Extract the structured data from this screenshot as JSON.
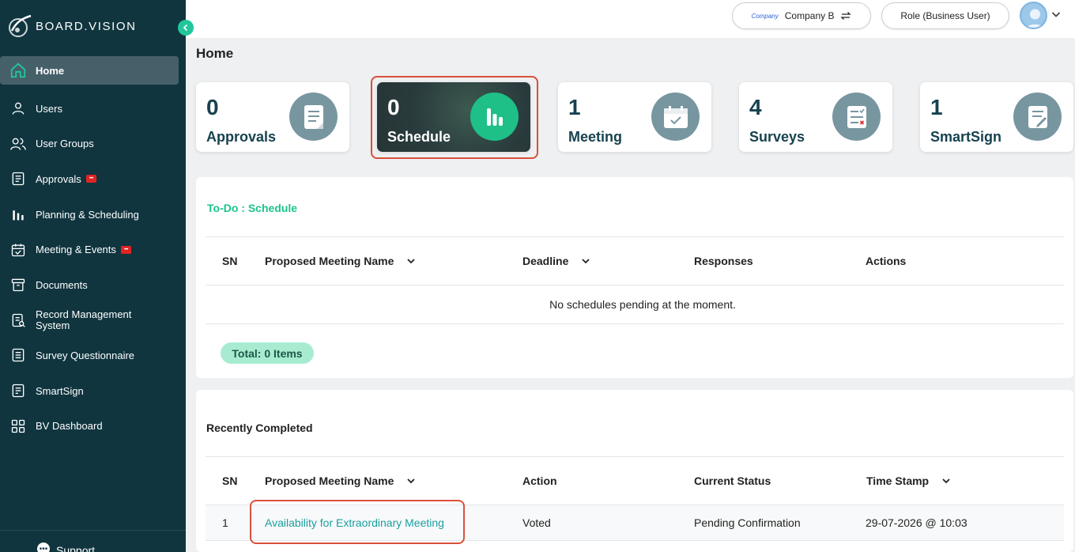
{
  "sidebar": {
    "logo_text": "BOARD.VISION",
    "items": [
      {
        "label": "Home",
        "icon": "home-icon",
        "active": true
      },
      {
        "label": "Users",
        "icon": "user-icon"
      },
      {
        "label": "User Groups",
        "icon": "users-icon"
      },
      {
        "label": "Approvals",
        "icon": "document-icon",
        "badge": true
      },
      {
        "label": "Planning & Scheduling",
        "icon": "bar-chart-icon"
      },
      {
        "label": "Meeting & Events",
        "icon": "calendar-check-icon",
        "badge": true
      },
      {
        "label": "Documents",
        "icon": "archive-icon"
      },
      {
        "label": "Record Management System",
        "icon": "record-icon"
      },
      {
        "label": "Survey Questionnaire",
        "icon": "survey-icon"
      },
      {
        "label": "SmartSign",
        "icon": "sign-icon"
      },
      {
        "label": "BV Dashboard",
        "icon": "grid-icon"
      }
    ],
    "support_label": "Support"
  },
  "topbar": {
    "company_logo_text": "Company",
    "company_label": "Company B",
    "role_label": "Role (Business User)"
  },
  "page_title": "Home",
  "cards": [
    {
      "count": "0",
      "label": "Approvals",
      "icon": "approvals-doc-icon"
    },
    {
      "count": "0",
      "label": "Schedule",
      "icon": "schedule-bars-icon",
      "active": true
    },
    {
      "count": "1",
      "label": "Meeting",
      "icon": "meeting-calendar-icon"
    },
    {
      "count": "4",
      "label": "Surveys",
      "icon": "surveys-checklist-icon"
    },
    {
      "count": "1",
      "label": "SmartSign",
      "icon": "smartsign-pen-icon"
    }
  ],
  "todo": {
    "title": "To-Do : Schedule",
    "columns": [
      "SN",
      "Proposed Meeting Name",
      "Deadline",
      "Responses",
      "Actions"
    ],
    "empty_message": "No schedules pending at the moment.",
    "total_label": "Total: 0 Items"
  },
  "recent": {
    "title": "Recently Completed",
    "columns": [
      "SN",
      "Proposed Meeting Name",
      "Action",
      "Current Status",
      "Time Stamp"
    ],
    "rows": [
      {
        "sn": "1",
        "name": "Availability for Extraordinary Meeting",
        "action": "Voted",
        "status": "Pending Confirmation",
        "timestamp": "29-07-2026 @ 10:03"
      }
    ]
  },
  "colors": {
    "sidebar_bg": "#10353f",
    "accent": "#1bc48e",
    "highlight": "#d9503a",
    "link": "#1a9fa0"
  }
}
